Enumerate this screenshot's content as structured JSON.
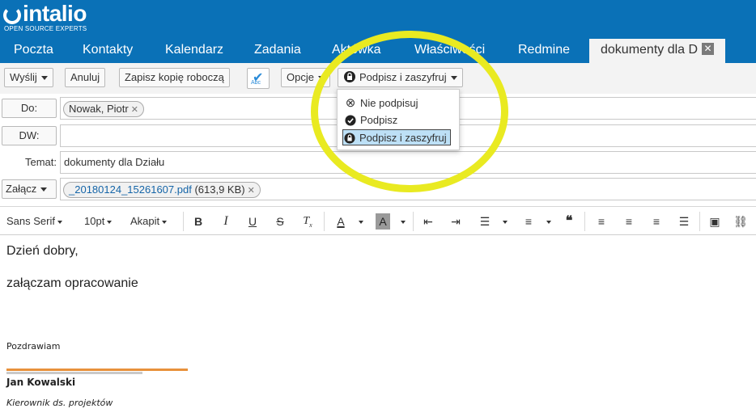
{
  "brand": {
    "name": "intalio",
    "tagline": "OPEN SOURCE EXPERTS"
  },
  "nav": {
    "tabs": [
      {
        "label": "Poczta"
      },
      {
        "label": "Kontakty"
      },
      {
        "label": "Kalendarz"
      },
      {
        "label": "Zadania"
      },
      {
        "label": "Aktówka"
      },
      {
        "label": "Właściwości"
      },
      {
        "label": "Redmine"
      }
    ],
    "active_tab": "dokumenty dla D",
    "close_glyph": "✕"
  },
  "toolbar": {
    "send": "Wyślij",
    "cancel": "Anuluj",
    "save_draft": "Zapisz kopię roboczą",
    "spell_text": "Abc",
    "options": "Opcje",
    "sign": "Podpisz i zaszyfruj"
  },
  "to": {
    "label": "Do:",
    "recipient": "Nowak, Piotr"
  },
  "cc": {
    "label": "DW:"
  },
  "subject": {
    "label": "Temat:",
    "value": "dokumenty dla Działu"
  },
  "attach": {
    "label": "Załącz",
    "file": "_20180124_15261607.pdf",
    "size": "(613,9 KB)"
  },
  "format": {
    "font": "Sans Serif",
    "size": "10pt",
    "paragraph": "Akapit"
  },
  "dropdown": {
    "items": [
      {
        "label": "Nie podpisuj",
        "icon": "no-sign-icon"
      },
      {
        "label": "Podpisz",
        "icon": "badge-check-icon"
      },
      {
        "label": "Podpisz i zaszyfruj",
        "icon": "badge-lock-icon",
        "selected": true
      }
    ]
  },
  "body": {
    "greeting": "Dzień dobry,",
    "line": "załączam opracowanie",
    "closing": "Pozdrawiam",
    "sig_name": "Jan Kowalski",
    "sig_title": "Kierownik ds. projektów"
  },
  "colors": {
    "header": "#0a71b7",
    "highlight": "#e9ea21",
    "signature_line": "#e8913b",
    "selected_item": "#bde0f6"
  }
}
